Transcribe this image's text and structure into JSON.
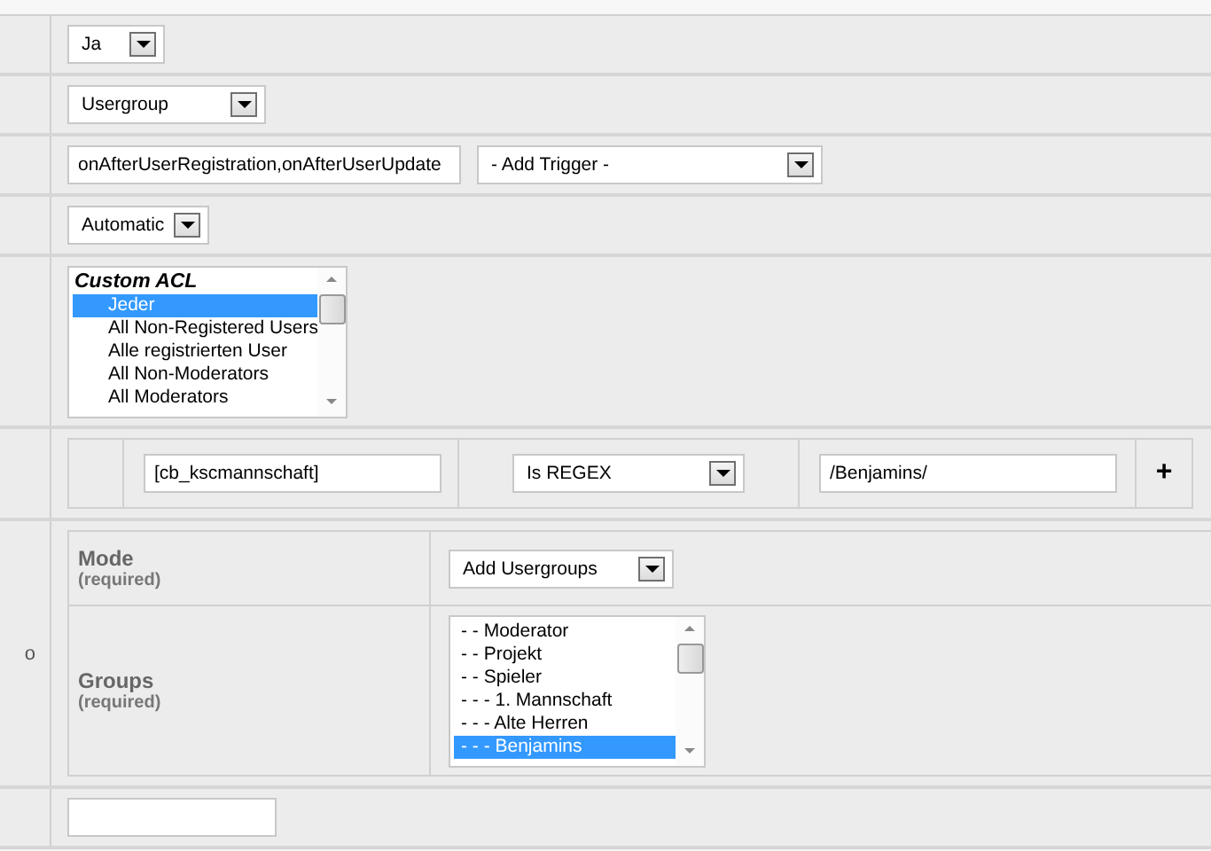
{
  "rows": [
    {
      "kind": "select",
      "value": "Ja"
    },
    {
      "kind": "select",
      "value": "Usergroup"
    },
    {
      "kind": "trigger",
      "input": "onAfterUserRegistration,onAfterUserUpdate",
      "select": "- Add Trigger -"
    },
    {
      "kind": "select",
      "value": "Automatic"
    },
    {
      "kind": "listbox",
      "options": [
        {
          "label": "Custom ACL",
          "kind": "group",
          "selected": false
        },
        {
          "label": "Jeder",
          "kind": "option",
          "selected": true
        },
        {
          "label": "All Non-Registered Users",
          "kind": "option",
          "selected": false
        },
        {
          "label": "Alle registrierten User",
          "kind": "option",
          "selected": false
        },
        {
          "label": "All Non-Moderators",
          "kind": "option",
          "selected": false
        },
        {
          "label": "All Moderators",
          "kind": "option",
          "selected": false
        }
      ]
    },
    {
      "kind": "condition",
      "field": "[cb_kscmannschaft]",
      "operator": "Is REGEX",
      "value": "/Benjamins/",
      "add": "+"
    },
    {
      "kind": "params",
      "label": "o",
      "params": [
        {
          "kind": "select",
          "label": "Mode",
          "note": "(required)",
          "value": "Add Usergroups"
        },
        {
          "kind": "listbox",
          "label": "Groups",
          "note": "(required)",
          "options": [
            {
              "label": "- - Moderator",
              "selected": false
            },
            {
              "label": "- - Projekt",
              "selected": false
            },
            {
              "label": "- - Spieler",
              "selected": false
            },
            {
              "label": "- - - 1. Mannschaft",
              "selected": false
            },
            {
              "label": "- - - Alte Herren",
              "selected": false
            },
            {
              "label": "- - - Benjamins",
              "selected": true
            }
          ]
        }
      ]
    },
    {
      "kind": "input",
      "value": ""
    }
  ]
}
